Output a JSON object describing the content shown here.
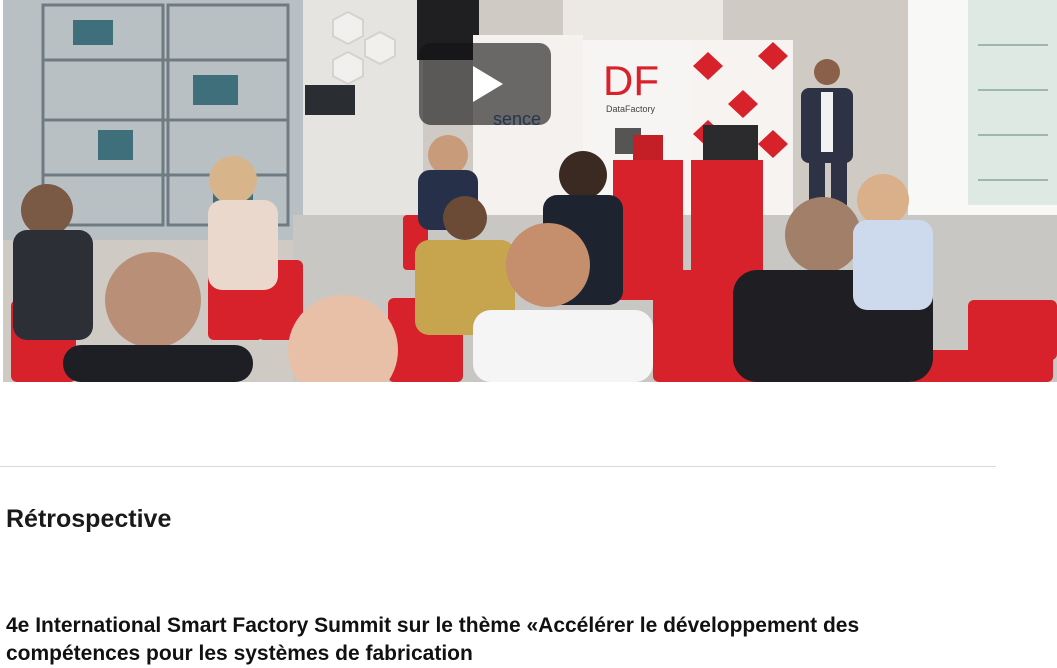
{
  "video": {
    "play_icon": "play-icon",
    "backdrop_texts": [
      "sence",
      "DF",
      "DataFactory"
    ]
  },
  "section": {
    "title": "Rétrospective"
  },
  "article": {
    "heading": "4e International Smart Factory Summit sur le thème «Accélérer le développement des compétences pour les systèmes de fabrication"
  },
  "colors": {
    "accent_red": "#d8222b",
    "divider": "#d9d9d9",
    "text": "#1a1a1a"
  }
}
